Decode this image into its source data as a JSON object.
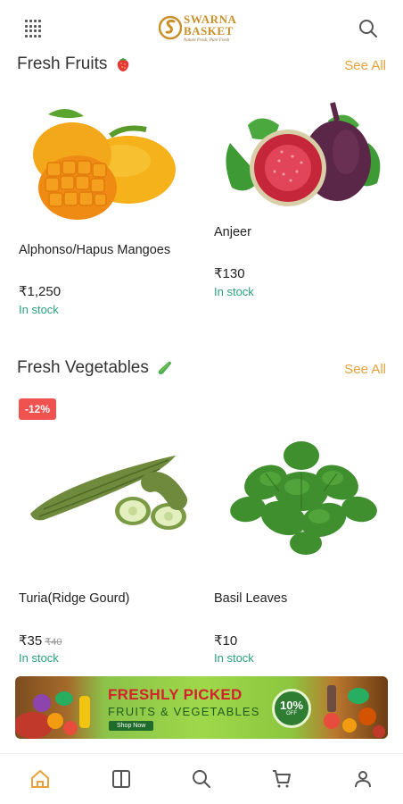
{
  "header": {
    "logo_line1": "SWARNA",
    "logo_line2": "BASKET",
    "logo_tagline": "Nature Fresh, Pure Fresh",
    "logo_color": "#c9902a"
  },
  "sections": [
    {
      "title": "Fresh Fruits",
      "emoji": "strawberry-icon",
      "see_all": "See All",
      "products": [
        {
          "name": "Alphonso/Hapus Mangoes",
          "price": "₹1,250",
          "stock": "In stock",
          "image": "mango-image"
        },
        {
          "name": "Anjeer",
          "price": "₹130",
          "stock": "In stock",
          "image": "fig-image"
        }
      ]
    },
    {
      "title": "Fresh Vegetables",
      "emoji": "cucumber-icon",
      "see_all": "See All",
      "products": [
        {
          "name": "Turia(Ridge Gourd)",
          "price": "₹35",
          "old_price": "₹40",
          "discount": "-12%",
          "stock": "In stock",
          "image": "ridge-gourd-image"
        },
        {
          "name": "Basil Leaves",
          "price": "₹10",
          "stock": "In stock",
          "image": "basil-image"
        }
      ]
    }
  ],
  "banner": {
    "title": "FRESHLY PICKED",
    "subtitle": "FRUITS & VEGETABLES",
    "button": "Shop Now",
    "badge_pct": "10%",
    "badge_off": "OFF"
  },
  "bottom_nav": [
    "home-icon",
    "catalog-icon",
    "search-icon",
    "cart-icon",
    "profile-icon"
  ],
  "colors": {
    "accent": "#e8a13a",
    "stock": "#2aa37a",
    "discount": "#f0524f",
    "nav_active": "#e8a13a"
  }
}
